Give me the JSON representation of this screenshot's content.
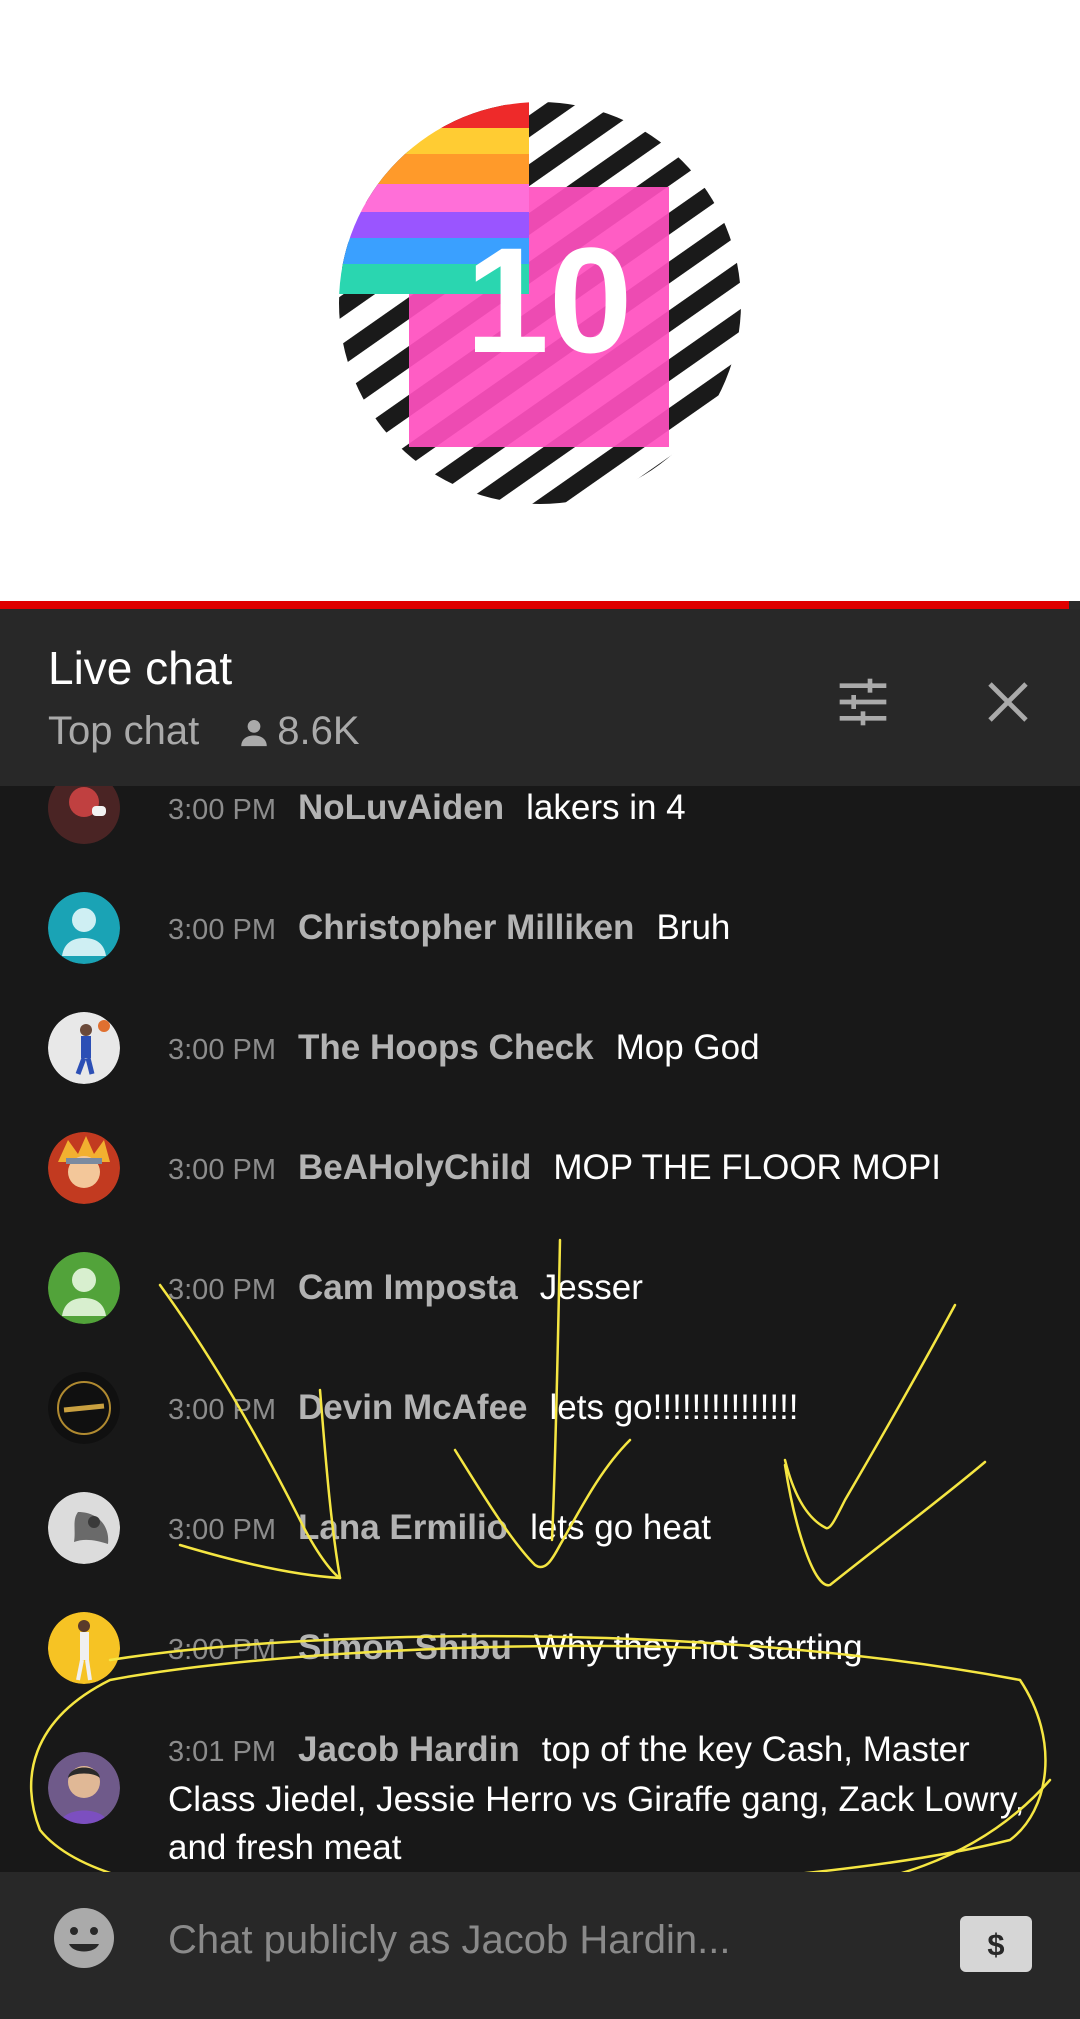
{
  "video": {
    "progress": 0.99
  },
  "header": {
    "title": "Live chat",
    "mode": "Top chat",
    "viewers": "8.6K",
    "filter_icon": "tune-icon",
    "close_icon": "close-icon"
  },
  "messages": [
    {
      "time": "3:00 PM",
      "author": "NoLuvAiden",
      "text": "lakers in 4",
      "avatar": "red-character-avatar"
    },
    {
      "time": "3:00 PM",
      "author": "Christopher Milliken",
      "text": "Bruh",
      "avatar": "default-avatar-teal"
    },
    {
      "time": "3:00 PM",
      "author": "The Hoops Check",
      "text": "Mop God",
      "avatar": "basketball-player-avatar"
    },
    {
      "time": "3:00 PM",
      "author": "BeAHolyChild",
      "text": "MOP THE FLOOR MOPI",
      "avatar": "anime-avatar"
    },
    {
      "time": "3:00 PM",
      "author": "Cam Imposta",
      "text": "Jesser",
      "avatar": "default-avatar-green"
    },
    {
      "time": "3:00 PM",
      "author": "Devin McAfee",
      "text": "lets go!!!!!!!!!!!!!!!",
      "avatar": "lakers-logo-avatar"
    },
    {
      "time": "3:00 PM",
      "author": "Lana Ermilio",
      "text": "lets go heat",
      "avatar": "grayscale-photo-avatar"
    },
    {
      "time": "3:00 PM",
      "author": "Simon Shibu",
      "text": "Why they not starting",
      "avatar": "yellow-player-avatar"
    },
    {
      "time": "3:01 PM",
      "author": "Jacob Hardin",
      "text": "top of the key Cash, Master Class Jiedel, Jessie Herro vs Giraffe gang, Zack Lowry, and fresh meat",
      "avatar": "jacob-photo-avatar"
    }
  ],
  "input": {
    "placeholder": "Chat publicly as Jacob Hardin...",
    "emoji_icon": "emoji-icon",
    "superchat_icon": "dollar-icon"
  },
  "colors": {
    "progress": "#e00000",
    "header_bg": "#282828",
    "chat_bg": "#181818",
    "annotation": "#f5e642"
  }
}
